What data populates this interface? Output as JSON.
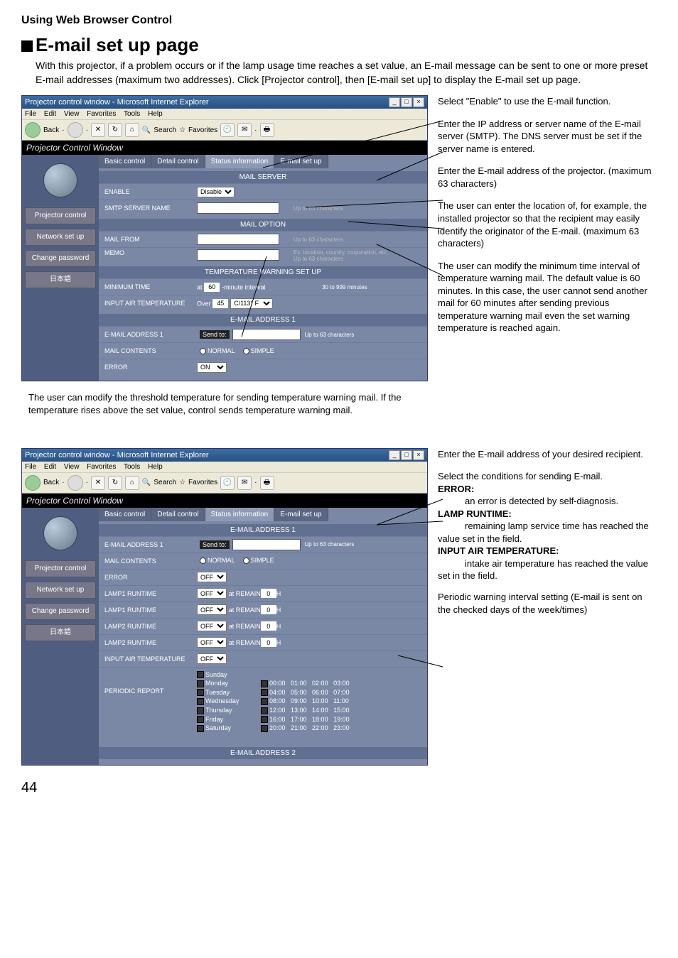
{
  "page_number": "44",
  "section_title": "Using Web Browser Control",
  "heading": "E-mail set up page",
  "intro_text": "With this projector, if a problem occurs or if the lamp usage time reaches a set value, an E-mail message can be sent to one or more preset E-mail addresses (maximum two addresses). Click [Projector control], then [E-mail set up] to display the E-mail set up page.",
  "browser": {
    "title": "Projector control window - Microsoft Internet Explorer",
    "menu": {
      "file": "File",
      "edit": "Edit",
      "view": "View",
      "favorites": "Favorites",
      "tools": "Tools",
      "help": "Help"
    },
    "toolbar": {
      "back": "Back",
      "search": "Search",
      "favorites": "Favorites"
    }
  },
  "pcw": {
    "caption": "Projector Control Window",
    "side": {
      "projector_control": "Projector control",
      "network_setup": "Network set up",
      "change_password": "Change password",
      "japanese": "日本語"
    },
    "top_tabs": {
      "basic": "Basic control",
      "detail": "Detail control",
      "status": "Status information",
      "email": "E-mail set up"
    }
  },
  "screen1": {
    "mail_server_hdr": "MAIL SERVER",
    "enable_lbl": "ENABLE",
    "enable_val": "Disable",
    "smtp_lbl": "SMTP SERVER NAME",
    "smtp_hint": "Up to 63 characters",
    "mail_option_hdr": "MAIL OPTION",
    "from_lbl": "MAIL FROM",
    "from_hint": "Up to 63 characters",
    "memo_lbl": "MEMO",
    "memo_hint": "Ex. location, country, corporation, etc.\nUp to 63 characters",
    "temp_hdr": "TEMPERATURE WARNING SET UP",
    "min_time_lbl": "MINIMUM TIME",
    "min_time_prefix": "at",
    "min_time_val": "60",
    "min_time_suffix": "-minute interval",
    "min_time_hint": "30 to 999 minutes",
    "input_temp_lbl": "INPUT AIR TEMPERATURE",
    "input_temp_prefix": "Over",
    "input_temp_val": "45",
    "input_temp_unit": "C/113° F",
    "addr1_hdr": "E-MAIL ADDRESS 1",
    "addr1_lbl": "E-MAIL ADDRESS 1",
    "sendto": "Send to:",
    "addr_hint": "Up to 63 characters",
    "contents_lbl": "MAIL CONTENTS",
    "contents_normal": "NORMAL",
    "contents_simple": "SIMPLE",
    "error_lbl": "ERROR",
    "error_val": "ON"
  },
  "callouts1": {
    "a": "Select \"Enable\" to use the E-mail function.",
    "b": "Enter the IP address or server name of the E-mail server (SMTP). The DNS server must be set if the server name is entered.",
    "c": "Enter the E-mail address of the projector. (maximum 63 characters)",
    "d": "The user can enter the location of, for example, the installed projector so that the recipient may easily identify the originator of the E-mail. (maximum 63 characters)",
    "e": "The user can modify the minimum time interval of temperature warning mail.  The default value is 60 minutes.  In this case, the user cannot send another mail for 60 minutes after sending previous temperature warning mail even the set warning temperature is reached again."
  },
  "below1": "The user can modify the threshold temperature for sending temperature warning mail. If the temperature rises above the set value, control sends temperature warning mail.",
  "screen2": {
    "addr1_hdr": "E-MAIL ADDRESS 1",
    "addr1_lbl": "E-MAIL ADDRESS 1",
    "sendto": "Send to:",
    "addr_hint": "Up to 63 characters",
    "contents_lbl": "MAIL CONTENTS",
    "normal": "NORMAL",
    "simple": "SIMPLE",
    "error_lbl": "ERROR",
    "off": "OFF",
    "lamp1_rt1": "LAMP1 RUNTIME",
    "lamp1_rt2": "LAMP1 RUNTIME",
    "lamp2_rt1": "LAMP2 RUNTIME",
    "lamp2_rt2": "LAMP2 RUNTIME",
    "at_remain": "at REMAIN",
    "remain_val": "0",
    "h_unit": "H",
    "input_temp_lbl": "INPUT AIR TEMPERATURE",
    "periodic_lbl": "PERIODIC REPORT",
    "days": {
      "sun": "Sunday",
      "mon": "Monday",
      "tue": "Tuesday",
      "wed": "Wednesday",
      "thu": "Thursday",
      "fri": "Friday",
      "sat": "Saturday"
    },
    "times_row1": "00:00   01:00   02:00   03:00",
    "times_row2": "04:00   05:00   06:00   07:00",
    "times_row3": "08:00   09:00   10:00   11:00",
    "times_row4": "12:00   13:00   14:00   15:00",
    "times_row5": "16:00   17:00   18:00   19:00",
    "times_row6": "20:00   21:00   22:00   23:00",
    "addr2_hdr": "E-MAIL ADDRESS 2"
  },
  "callouts2": {
    "a": "Enter the E-mail address of your desired recipient.",
    "b": "Select the conditions for sending E-mail.",
    "error_h": "ERROR:",
    "error_t": "an error is detected by self-diagnosis.",
    "lamp_h": "LAMP RUNTIME:",
    "lamp_t": "remaining lamp service time has reached the value set in the field.",
    "iat_h": "INPUT AIR TEMPERATURE:",
    "iat_t": "intake air temperature has reached the value set in the field.",
    "c": "Periodic warning interval setting (E-mail is sent on the checked days of the week/times)"
  }
}
